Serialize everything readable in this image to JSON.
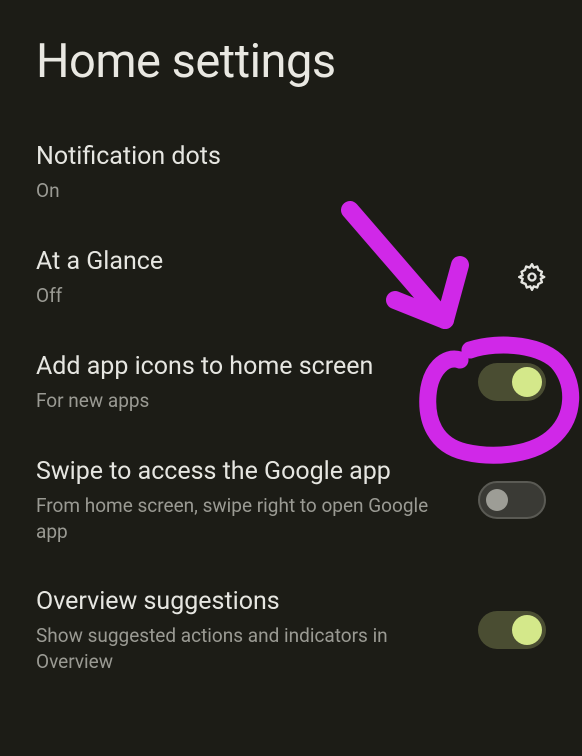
{
  "header": {
    "title": "Home settings"
  },
  "settings": {
    "notification_dots": {
      "title": "Notification dots",
      "value": "On"
    },
    "at_a_glance": {
      "title": "At a Glance",
      "value": "Off"
    },
    "add_icons": {
      "title": "Add app icons to home screen",
      "subtitle": "For new apps",
      "toggle": "on"
    },
    "swipe_google": {
      "title": "Swipe to access the Google app",
      "subtitle": "From home screen, swipe right to open Google app",
      "toggle": "off"
    },
    "overview": {
      "title": "Overview suggestions",
      "subtitle": "Show suggested actions and indicators in Overview",
      "toggle": "on"
    }
  }
}
